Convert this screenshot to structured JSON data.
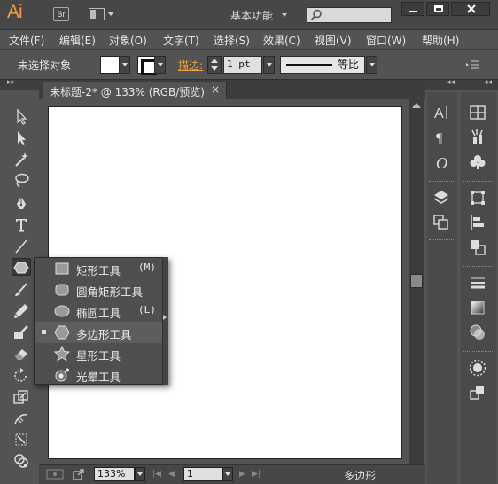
{
  "app": {
    "logo": "Ai",
    "bridge_label": "Br",
    "workspace": "基本功能",
    "search_placeholder": ""
  },
  "menu": [
    "文件(F)",
    "编辑(E)",
    "对象(O)",
    "文字(T)",
    "选择(S)",
    "效果(C)",
    "视图(V)",
    "窗口(W)",
    "帮助(H)"
  ],
  "control_bar": {
    "selection_status": "未选择对象",
    "stroke_label": "描边:",
    "stroke_weight": "1 pt",
    "profile_label": "等比"
  },
  "document": {
    "tab_title": "未标题-2* @ 133% (RGB/预览)",
    "close_glyph": "×"
  },
  "status_bar": {
    "zoom": "133%",
    "page": "1",
    "current_tool": "多边形"
  },
  "flyout": {
    "items": [
      {
        "label": "矩形工具",
        "shortcut": "(M)",
        "icon": "rectangle-icon",
        "active": false
      },
      {
        "label": "圆角矩形工具",
        "shortcut": "",
        "icon": "rounded-rectangle-icon",
        "active": false
      },
      {
        "label": "椭圆工具",
        "shortcut": "(L)",
        "icon": "ellipse-icon",
        "active": false
      },
      {
        "label": "多边形工具",
        "shortcut": "",
        "icon": "polygon-icon",
        "active": true
      },
      {
        "label": "星形工具",
        "shortcut": "",
        "icon": "star-icon",
        "active": false
      },
      {
        "label": "光晕工具",
        "shortcut": "",
        "icon": "flare-icon",
        "active": false
      }
    ]
  },
  "colors": {
    "accent": "#f39a3e",
    "background": "#535353",
    "artboard": "#ffffff"
  }
}
